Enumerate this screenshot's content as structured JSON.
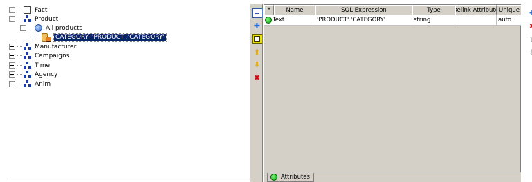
{
  "tree": {
    "items": [
      {
        "label": "Fact",
        "icon": "fact-table-icon",
        "expander": "plus"
      },
      {
        "label": "Product",
        "icon": "dimension-icon",
        "expander": "minus"
      },
      {
        "label": "All products",
        "icon": "hierarchy-icon",
        "expander": "minus"
      },
      {
        "label": "CATEGORY: 'PRODUCT'.'CATEGORY'",
        "icon": "level-icon",
        "selected": true
      },
      {
        "label": "Manufacturer",
        "icon": "dimension-icon",
        "expander": "plus"
      },
      {
        "label": "Campaigns",
        "icon": "dimension-icon",
        "expander": "plus"
      },
      {
        "label": "Time",
        "icon": "dimension-icon",
        "expander": "plus"
      },
      {
        "label": "Agency",
        "icon": "dimension-icon",
        "expander": "plus"
      },
      {
        "label": "Anim",
        "icon": "dimension-icon",
        "expander": "plus"
      }
    ]
  },
  "toolbar": {
    "buttons": [
      "collapse-icon",
      "add-icon",
      "edit-icon",
      "move-up-icon",
      "move-down-icon",
      "delete-icon"
    ]
  },
  "grid": {
    "columns": [
      "*",
      "Name",
      "SQL Expression",
      "Type",
      "Relink Attribute",
      "Unique"
    ],
    "rows": [
      {
        "status": "green-dot-icon",
        "name": "Text",
        "sql": "'PRODUCT'.'CATEGORY'",
        "type": "string",
        "relink": "",
        "unique": "auto"
      }
    ]
  },
  "tabs": {
    "attributes": "Attributes"
  },
  "colors": {
    "selection": "#0a246a",
    "panel": "#d4d0c8",
    "status_green": "#0a9a0a"
  }
}
